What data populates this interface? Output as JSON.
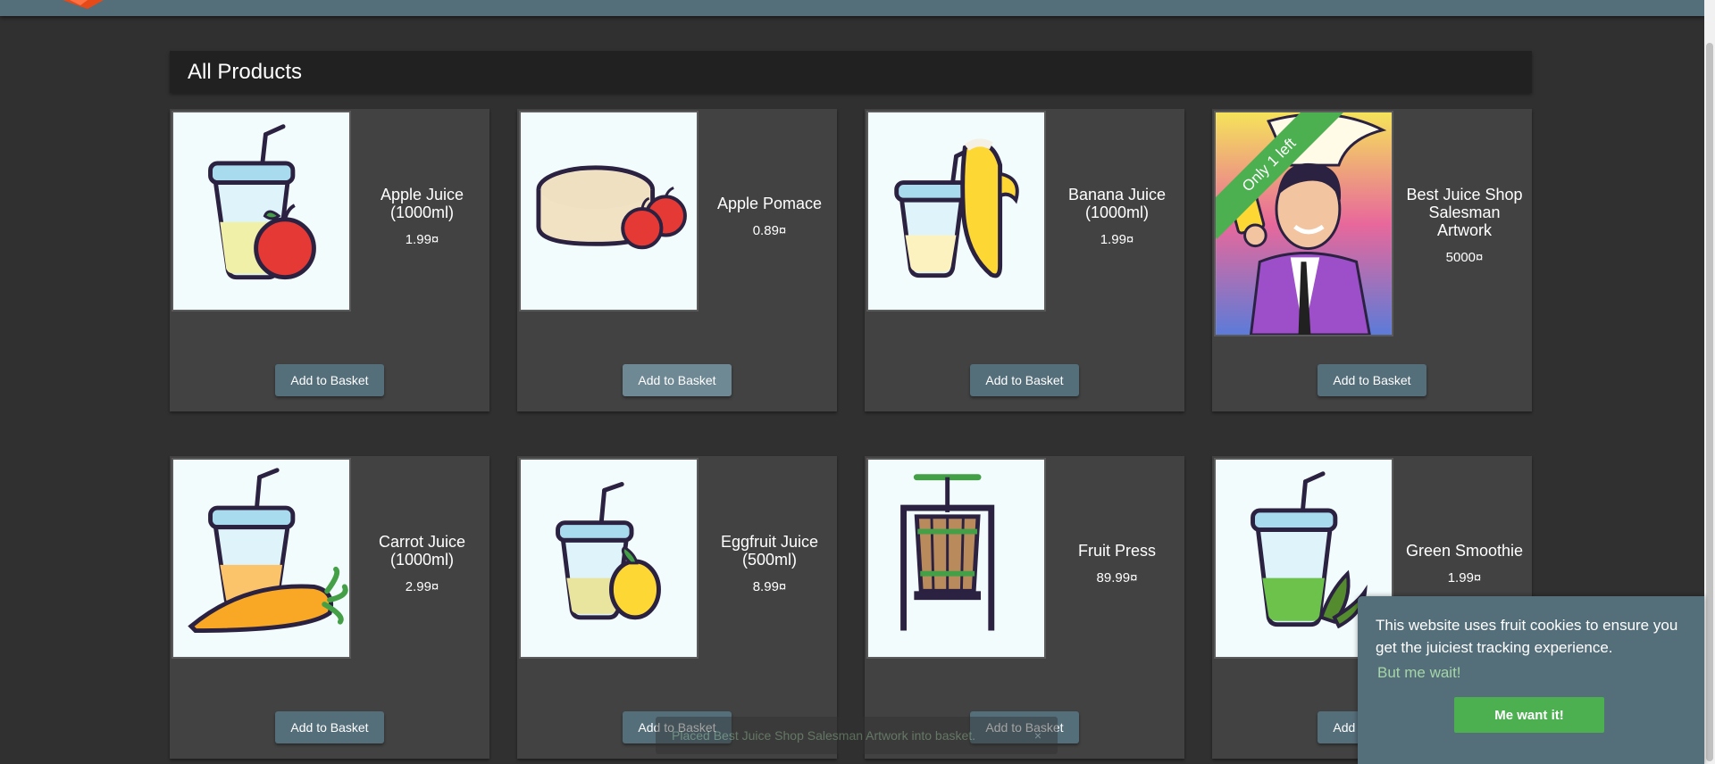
{
  "page": {
    "heading": "All Products"
  },
  "products": [
    {
      "name": "Apple Juice (1000ml)",
      "price": "1.99¤",
      "button": "Add to Basket",
      "icon": "apple-juice-icon"
    },
    {
      "name": "Apple Pomace",
      "price": "0.89¤",
      "button": "Add to Basket",
      "icon": "apple-pomace-icon"
    },
    {
      "name": "Banana Juice (1000ml)",
      "price": "1.99¤",
      "button": "Add to Basket",
      "icon": "banana-juice-icon"
    },
    {
      "name": "Best Juice Shop Salesman Artwork",
      "price": "5000¤",
      "button": "Add to Basket",
      "ribbon": "Only 1 left",
      "icon": "salesman-artwork-image"
    },
    {
      "name": "Carrot Juice (1000ml)",
      "price": "2.99¤",
      "button": "Add to Basket",
      "icon": "carrot-juice-icon"
    },
    {
      "name": "Eggfruit Juice (500ml)",
      "price": "8.99¤",
      "button": "Add to Basket",
      "icon": "eggfruit-juice-icon"
    },
    {
      "name": "Fruit Press",
      "price": "89.99¤",
      "button": "Add to Basket",
      "icon": "fruit-press-icon"
    },
    {
      "name": "Green Smoothie",
      "price": "1.99¤",
      "button": "Add to Basket",
      "icon": "green-smoothie-icon"
    }
  ],
  "snackbar": {
    "message": "Placed Best Juice Shop Salesman Artwork into basket.",
    "close": "×"
  },
  "cookie": {
    "message": "This website uses fruit cookies to ensure you get the juiciest tracking experience.",
    "learn_more": "But me wait!",
    "accept": "Me want it!"
  },
  "colors": {
    "toolbar": "#546e7a",
    "background": "#303030",
    "card": "#424242",
    "accent": "#4caf50"
  }
}
